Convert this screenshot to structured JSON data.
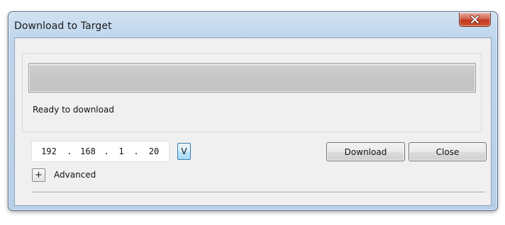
{
  "window": {
    "title": "Download to Target"
  },
  "status": {
    "progress_fraction": 0,
    "message": "Ready to download"
  },
  "target": {
    "ip_octets": [
      "192",
      "168",
      "1",
      "20"
    ],
    "separator": ".",
    "dropdown_label": "V"
  },
  "buttons": {
    "download": "Download",
    "close": "Close"
  },
  "advanced": {
    "toggle_symbol": "+",
    "label": "Advanced"
  },
  "icons": {
    "close": "close-x-icon"
  },
  "colors": {
    "close_button": "#c8412a",
    "progress_fill": "#06b025"
  }
}
